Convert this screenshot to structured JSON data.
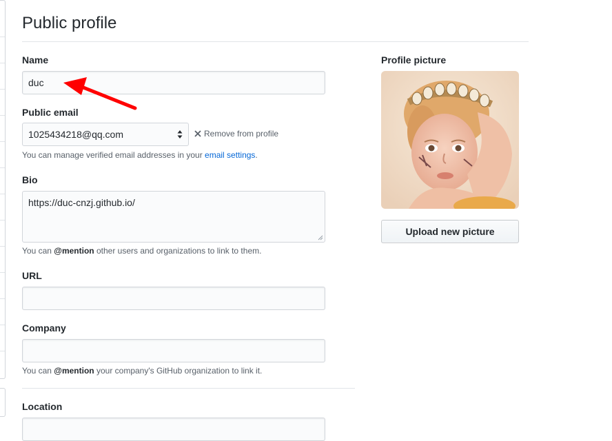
{
  "page": {
    "title": "Public profile"
  },
  "fields": {
    "name": {
      "label": "Name",
      "value": "duc"
    },
    "public_email": {
      "label": "Public email",
      "selected": "1025434218@qq.com",
      "remove_label": "Remove from profile",
      "note_prefix": "You can manage verified email addresses in your ",
      "note_link": "email settings",
      "note_suffix": "."
    },
    "bio": {
      "label": "Bio",
      "value": "https://duc-cnzj.github.io/",
      "note_prefix": "You can ",
      "note_mention": "@mention",
      "note_suffix": " other users and organizations to link to them."
    },
    "url": {
      "label": "URL",
      "value": ""
    },
    "company": {
      "label": "Company",
      "value": "",
      "note_prefix": "You can ",
      "note_mention": "@mention",
      "note_suffix": " your company's GitHub organization to link it."
    },
    "location": {
      "label": "Location",
      "value": ""
    }
  },
  "profile_picture": {
    "label": "Profile picture",
    "upload_label": "Upload new picture"
  },
  "annotation": {
    "color": "#ff0000"
  },
  "colors": {
    "link": "#0366d6",
    "text": "#24292e",
    "muted": "#586069"
  }
}
